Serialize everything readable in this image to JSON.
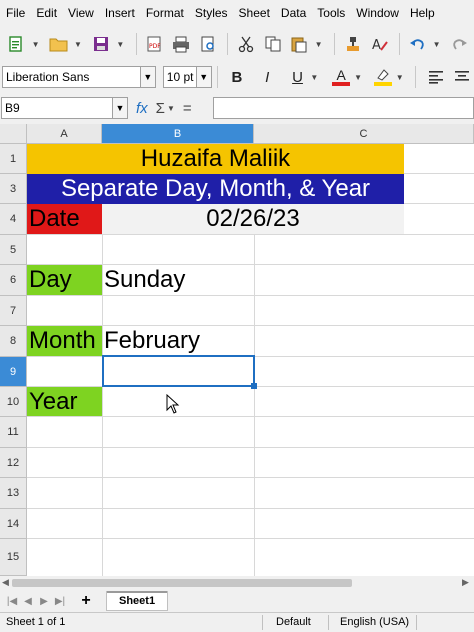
{
  "menu": [
    "File",
    "Edit",
    "View",
    "Insert",
    "Format",
    "Styles",
    "Sheet",
    "Data",
    "Tools",
    "Window",
    "Help"
  ],
  "toolbar": {
    "icons": [
      "new-document-icon",
      "open-folder-icon",
      "save-icon",
      "export-pdf-icon",
      "print-icon",
      "print-preview-icon",
      "cut-icon",
      "copy-icon",
      "paste-icon",
      "clone-formatting-icon",
      "clear-formatting-icon",
      "undo-icon",
      "redo-icon"
    ]
  },
  "format": {
    "font_name": "Liberation Sans",
    "font_size": "10 pt",
    "bold": "B",
    "italic": "I",
    "underline": "U",
    "font_color_label": "A",
    "font_color": "#e02020",
    "highlight_color": "#ffd400"
  },
  "formula": {
    "cell_ref": "B9",
    "fx": "fx",
    "sigma": "Σ",
    "equals": "=",
    "content": ""
  },
  "grid": {
    "columns": [
      "A",
      "B",
      "C"
    ],
    "rows": [
      "1",
      "3",
      "4",
      "5",
      "6",
      "7",
      "8",
      "9",
      "10",
      "11",
      "12",
      "13",
      "14",
      "15"
    ],
    "selected_col": "B",
    "selected_row": "9"
  },
  "cells": {
    "title": "Huzaifa Maliik",
    "subtitle": "Separate Day, Month, & Year",
    "date_label": "Date",
    "date_value": "02/26/23",
    "day_label": "Day",
    "day_value": "Sunday",
    "month_label": "Month",
    "month_value": "February",
    "year_label": "Year"
  },
  "colors": {
    "title_bg": "#f5c400",
    "subtitle_bg": "#1f1fa8",
    "date_label_bg": "#e01818",
    "label_green": "#7ed321",
    "selection": "#1f6fc2"
  },
  "tabs": {
    "add": "+",
    "sheet": "Sheet1"
  },
  "status": {
    "sheet_info": "Sheet 1 of 1",
    "page_style": "Default",
    "language": "English (USA)"
  }
}
